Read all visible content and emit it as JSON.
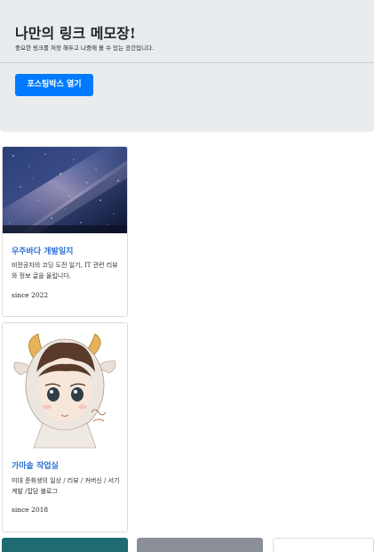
{
  "header": {
    "title": "나만의 링크 메모장!",
    "subtitle": "중요한 링크를 저장 해두고 나중에 볼 수 있는 공간입니다.",
    "open_posting_button": "포스팅박스 열기"
  },
  "cards": [
    {
      "title": "우주바다 개발일지",
      "description": "비전공자의 코딩 도전 일기, IT 관련 리뷰와 정보 글을 올립니다.",
      "since": "since 2022",
      "image": "milky-way-night-sky"
    },
    {
      "title": "가마솥 작업실",
      "description": "미대 준휘생의 일상 / 리뷰 / 커버신 / 서기계발 /잡담 블로그",
      "since": "since 2018",
      "image": "illustrated-character-with-horns"
    }
  ],
  "colors": {
    "jumbotron_bg": "#e9ecef",
    "primary": "#007bff",
    "card_title": "#2f6fd4"
  }
}
